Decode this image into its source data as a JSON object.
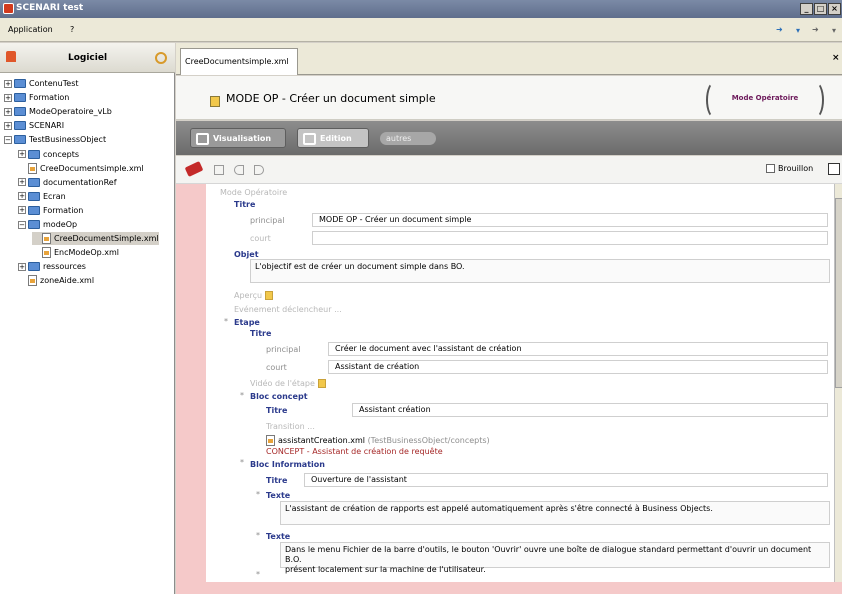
{
  "window": {
    "title": "SCENARI test",
    "controls": [
      "_",
      "□",
      "×"
    ]
  },
  "menu": {
    "application": "Application",
    "help": "?"
  },
  "left": {
    "title": "Logiciel",
    "tree": [
      {
        "label": "ContenuTest",
        "kind": "folder",
        "expander": "+",
        "indent": 0
      },
      {
        "label": "Formation",
        "kind": "folder",
        "expander": "+",
        "indent": 0
      },
      {
        "label": "ModeOperatoire_vLb",
        "kind": "folder",
        "expander": "+",
        "indent": 0
      },
      {
        "label": "SCENARI",
        "kind": "folder",
        "expander": "+",
        "indent": 0
      },
      {
        "label": "TestBusinessObject",
        "kind": "folder",
        "expander": "−",
        "indent": 0
      },
      {
        "label": "concepts",
        "kind": "folder",
        "expander": "+",
        "indent": 1
      },
      {
        "label": "CreeDocumentsimple.xml",
        "kind": "file",
        "expander": "",
        "indent": 1
      },
      {
        "label": "documentationRef",
        "kind": "folder",
        "expander": "+",
        "indent": 1
      },
      {
        "label": "Ecran",
        "kind": "folder",
        "expander": "+",
        "indent": 1
      },
      {
        "label": "Formation",
        "kind": "folder",
        "expander": "+",
        "indent": 1
      },
      {
        "label": "modeOp",
        "kind": "folder",
        "expander": "−",
        "indent": 1
      },
      {
        "label": "CreeDocumentSimple.xml",
        "kind": "file",
        "expander": "",
        "indent": 2,
        "selected": true
      },
      {
        "label": "EncModeOp.xml",
        "kind": "file",
        "expander": "",
        "indent": 2
      },
      {
        "label": "ressources",
        "kind": "folder",
        "expander": "+",
        "indent": 1
      },
      {
        "label": "zoneAide.xml",
        "kind": "file",
        "expander": "",
        "indent": 1
      }
    ]
  },
  "tab": {
    "label": "CreeDocumentsimple.xml",
    "close": "×"
  },
  "doc": {
    "title": "MODE OP - Créer un document simple",
    "type": "Mode Opératoire"
  },
  "modes": {
    "visualisation": "Visualisation",
    "edition": "Edition",
    "autres": "autres"
  },
  "toolbar": {
    "brouillon": "Brouillon"
  },
  "editor": {
    "root": "Mode Opératoire",
    "titre": "Titre",
    "principal_label": "principal",
    "principal_value": "MODE OP - Créer un document simple",
    "court_label": "court",
    "objet": "Objet",
    "objet_text": "L'objectif est de créer un document simple dans BO.",
    "apercu": "Aperçu",
    "evenement": "Evénement déclencheur ...",
    "etape": "Etape",
    "etape_titre": "Titre",
    "etape_principal_label": "principal",
    "etape_principal_value": "Créer le document avec l'assistant de création",
    "etape_court_label": "court",
    "etape_court_value": "Assistant de création",
    "video": "Vidéo de l'étape",
    "bloc_concept": "Bloc concept",
    "bc_titre": "Titre",
    "bc_titre_value": "Assistant création",
    "transition": "Transition ...",
    "concept_file": "assistantCreation.xml",
    "concept_path": "(TestBusinessObject/concepts)",
    "concept_red": "CONCEPT - Assistant de création de requête",
    "bloc_info": "Bloc Information",
    "bi_titre": "Titre",
    "bi_titre_value": "Ouverture de l'assistant",
    "texte1": "Texte",
    "texte1_value": "L'assistant de création de rapports est appelé automatiquement après s'être connecté à Business Objects.",
    "texte2": "Texte",
    "texte2_value_l1": "Dans le menu Fichier de la barre d'outils, le bouton 'Ouvrir' ouvre une boîte de dialogue standard permettant d'ouvrir un document B.O.",
    "texte2_value_l2": "présent localement sur la machine de l'utilisateur."
  },
  "colors": {
    "accent": "#2b3a8c",
    "stripe": "#f5c9c9",
    "mode_label": "#6d1a5b"
  }
}
